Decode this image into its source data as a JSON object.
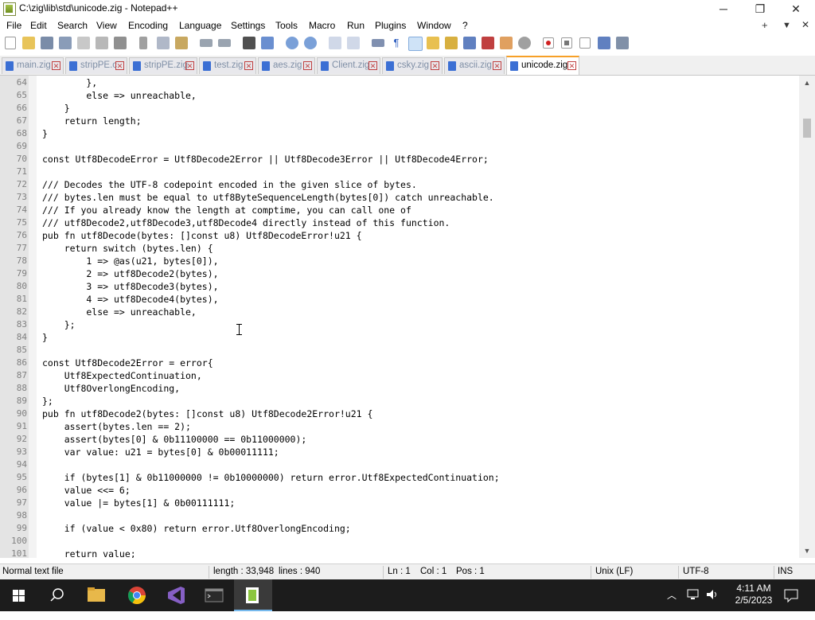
{
  "window": {
    "title": "C:\\zig\\lib\\std\\unicode.zig - Notepad++",
    "minimize": "─",
    "maximize": "❐",
    "close": "✕"
  },
  "menu": {
    "items": [
      "File",
      "Edit",
      "Search",
      "View",
      "Encoding",
      "Language",
      "Settings",
      "Tools",
      "Macro",
      "Run",
      "Plugins",
      "Window",
      "?"
    ],
    "extra": [
      "+",
      "▼",
      "✕"
    ]
  },
  "tabs": [
    {
      "label": "main.zig",
      "active": false
    },
    {
      "label": "stripPE.c",
      "active": false
    },
    {
      "label": "stripPE.zig",
      "active": false
    },
    {
      "label": "test.zig",
      "active": false
    },
    {
      "label": "aes.zig",
      "active": false
    },
    {
      "label": "Client.zig",
      "active": false
    },
    {
      "label": "csky.zig",
      "active": false
    },
    {
      "label": "ascii.zig",
      "active": false
    },
    {
      "label": "unicode.zig",
      "active": true
    }
  ],
  "editor": {
    "lines": [
      {
        "n": "64",
        "text": "        },"
      },
      {
        "n": "65",
        "text": "        else => unreachable,"
      },
      {
        "n": "66",
        "text": "    }"
      },
      {
        "n": "67",
        "text": "    return length;"
      },
      {
        "n": "68",
        "text": "}"
      },
      {
        "n": "69",
        "text": ""
      },
      {
        "n": "70",
        "text": "const Utf8DecodeError = Utf8Decode2Error || Utf8Decode3Error || Utf8Decode4Error;"
      },
      {
        "n": "71",
        "text": ""
      },
      {
        "n": "72",
        "text": "/// Decodes the UTF-8 codepoint encoded in the given slice of bytes."
      },
      {
        "n": "73",
        "text": "/// bytes.len must be equal to utf8ByteSequenceLength(bytes[0]) catch unreachable."
      },
      {
        "n": "74",
        "text": "/// If you already know the length at comptime, you can call one of"
      },
      {
        "n": "75",
        "text": "/// utf8Decode2,utf8Decode3,utf8Decode4 directly instead of this function."
      },
      {
        "n": "76",
        "text": "pub fn utf8Decode(bytes: []const u8) Utf8DecodeError!u21 {"
      },
      {
        "n": "77",
        "text": "    return switch (bytes.len) {"
      },
      {
        "n": "78",
        "text": "        1 => @as(u21, bytes[0]),"
      },
      {
        "n": "79",
        "text": "        2 => utf8Decode2(bytes),"
      },
      {
        "n": "80",
        "text": "        3 => utf8Decode3(bytes),"
      },
      {
        "n": "81",
        "text": "        4 => utf8Decode4(bytes),"
      },
      {
        "n": "82",
        "text": "        else => unreachable,"
      },
      {
        "n": "83",
        "text": "    };"
      },
      {
        "n": "84",
        "text": "}"
      },
      {
        "n": "85",
        "text": ""
      },
      {
        "n": "86",
        "text": "const Utf8Decode2Error = error{"
      },
      {
        "n": "87",
        "text": "    Utf8ExpectedContinuation,"
      },
      {
        "n": "88",
        "text": "    Utf8OverlongEncoding,"
      },
      {
        "n": "89",
        "text": "};"
      },
      {
        "n": "90",
        "text": "pub fn utf8Decode2(bytes: []const u8) Utf8Decode2Error!u21 {"
      },
      {
        "n": "91",
        "text": "    assert(bytes.len == 2);"
      },
      {
        "n": "92",
        "text": "    assert(bytes[0] & 0b11100000 == 0b11000000);"
      },
      {
        "n": "93",
        "text": "    var value: u21 = bytes[0] & 0b00011111;"
      },
      {
        "n": "94",
        "text": ""
      },
      {
        "n": "95",
        "text": "    if (bytes[1] & 0b11000000 != 0b10000000) return error.Utf8ExpectedContinuation;"
      },
      {
        "n": "96",
        "text": "    value <<= 6;"
      },
      {
        "n": "97",
        "text": "    value |= bytes[1] & 0b00111111;"
      },
      {
        "n": "98",
        "text": ""
      },
      {
        "n": "99",
        "text": "    if (value < 0x80) return error.Utf8OverlongEncoding;"
      },
      {
        "n": "100",
        "text": ""
      },
      {
        "n": "101",
        "text": "    return value;"
      }
    ]
  },
  "status": {
    "filetype": "Normal text file",
    "length": "length : 33,948",
    "lines": "lines : 940",
    "ln": "Ln : 1",
    "col": "Col : 1",
    "pos": "Pos : 1",
    "eol": "Unix (LF)",
    "encoding": "UTF-8",
    "mode": "INS"
  },
  "taskbar": {
    "time": "4:11 AM",
    "date": "2/5/2023"
  },
  "colors": {
    "active_tab_accent": "#f7a028",
    "tab_icon": "#3b6fd4",
    "taskbar": "#1c1c1c"
  }
}
